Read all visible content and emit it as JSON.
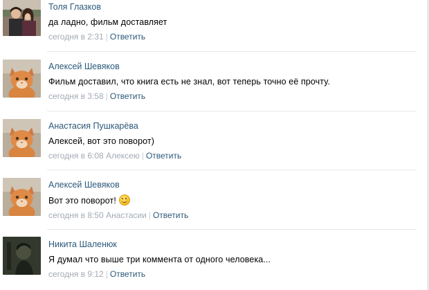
{
  "comments": [
    {
      "author": "Толя Глазков",
      "text": "да ладно, фильм доставляет",
      "date": "сегодня в 2:31",
      "addressee": "",
      "reply": "Ответить",
      "avatar": "couple-photo"
    },
    {
      "author": "Алексей Шевяков",
      "text": "Фильм доставил, что книга есть не знал, вот теперь точно её прочту.",
      "date": "сегодня в 3:58",
      "addressee": "",
      "reply": "Ответить",
      "avatar": "cat-photo"
    },
    {
      "author": "Анастасия Пушкарёва",
      "text": "Алексей, вот это поворот)",
      "date": "сегодня в 6:08",
      "addressee": "Алексею",
      "reply": "Ответить",
      "avatar": "cat-photo"
    },
    {
      "author": "Алексей Шевяков",
      "text": "Вот это поворот!",
      "date": "сегодня в 8:50",
      "addressee": "Анастасии",
      "reply": "Ответить",
      "avatar": "cat-photo",
      "emoji": "smile-emoji"
    },
    {
      "author": "Никита Шаленюк",
      "text": "Я думал что выше три коммента от одного человека...",
      "date": "сегодня в 9:12",
      "addressee": "",
      "reply": "Ответить",
      "avatar": "dark-portrait-photo"
    }
  ],
  "colors": {
    "author": "#2b587a",
    "meta": "#a3aab3",
    "divider": "#e3e7ec"
  }
}
